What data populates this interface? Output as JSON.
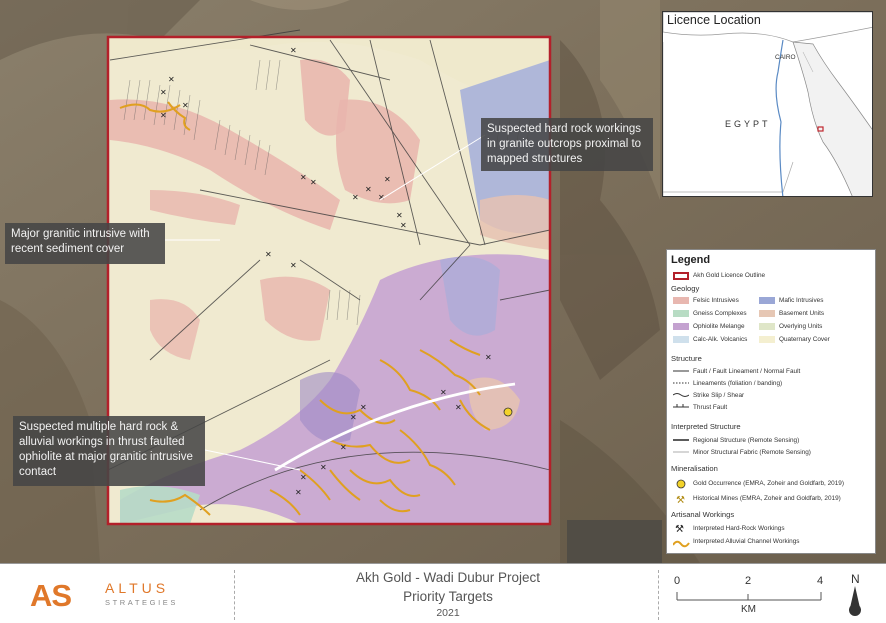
{
  "callouts": {
    "top_right": "Suspected hard rock workings in granite outcrops proximal to mapped structures",
    "middle_left": "Major granitic intrusive with recent sediment cover",
    "bottom_left": "Suspected multiple hard rock & alluvial workings in thrust faulted ophiolite at major granitic intrusive contact"
  },
  "inset": {
    "title": "Licence Location",
    "country": "EGYPT",
    "city": "CAIRO"
  },
  "legend": {
    "title": "Legend",
    "licence_outline": "Akh Gold Licence Outline",
    "geology_title": "Geology",
    "geology": [
      {
        "label": "Felsic Intrusives",
        "color": "#e8b7b0"
      },
      {
        "label": "Mafic Intrusives",
        "color": "#9aa7d6"
      },
      {
        "label": "Gneiss Complexes",
        "color": "#b8dcc4"
      },
      {
        "label": "Basement Units",
        "color": "#e6c7b4"
      },
      {
        "label": "Ophiolite Melange",
        "color": "#c4a2d0"
      },
      {
        "label": "Overlying Units",
        "color": "#dfe6c8"
      },
      {
        "label": "Calc-Alk. Volcanics",
        "color": "#cfe0ec"
      },
      {
        "label": "Quaternary Cover",
        "color": "#f4efd0"
      }
    ],
    "structure_title": "Structure",
    "structure": [
      "Fault / Fault Lineament / Normal Fault",
      "Lineaments (foliation / banding)",
      "Strike Slip / Shear",
      "Thrust Fault"
    ],
    "interpreted_title": "Interpreted Structure",
    "interpreted": [
      "Regional Structure (Remote Sensing)",
      "Minor Structural Fabric (Remote Sensing)"
    ],
    "mineral_title": "Mineralisation",
    "mineral": [
      "Gold Occurrence (EMRA, Zoheir and Goldfarb, 2019)",
      "Historical Mines (EMRA, Zoheir and Goldfarb, 2019)"
    ],
    "artisanal_title": "Artisanal Workings",
    "artisanal": [
      "Interpreted Hard-Rock Workings",
      "Interpreted Alluvial Channel Workings"
    ]
  },
  "footer": {
    "logo_as": "AS",
    "logo_altus": "ALTUS",
    "logo_strategies": "STRATEGIES",
    "title": "Akh Gold - Wadi Dubur Project",
    "subtitle": "Priority Targets",
    "year": "2021",
    "scale_labels": [
      "0",
      "2",
      "4"
    ],
    "scale_unit": "KM",
    "north": "N"
  },
  "colors": {
    "licence_outline": "#b3202a",
    "workings": "#e0a020",
    "logo_orange": "#e0782a"
  }
}
